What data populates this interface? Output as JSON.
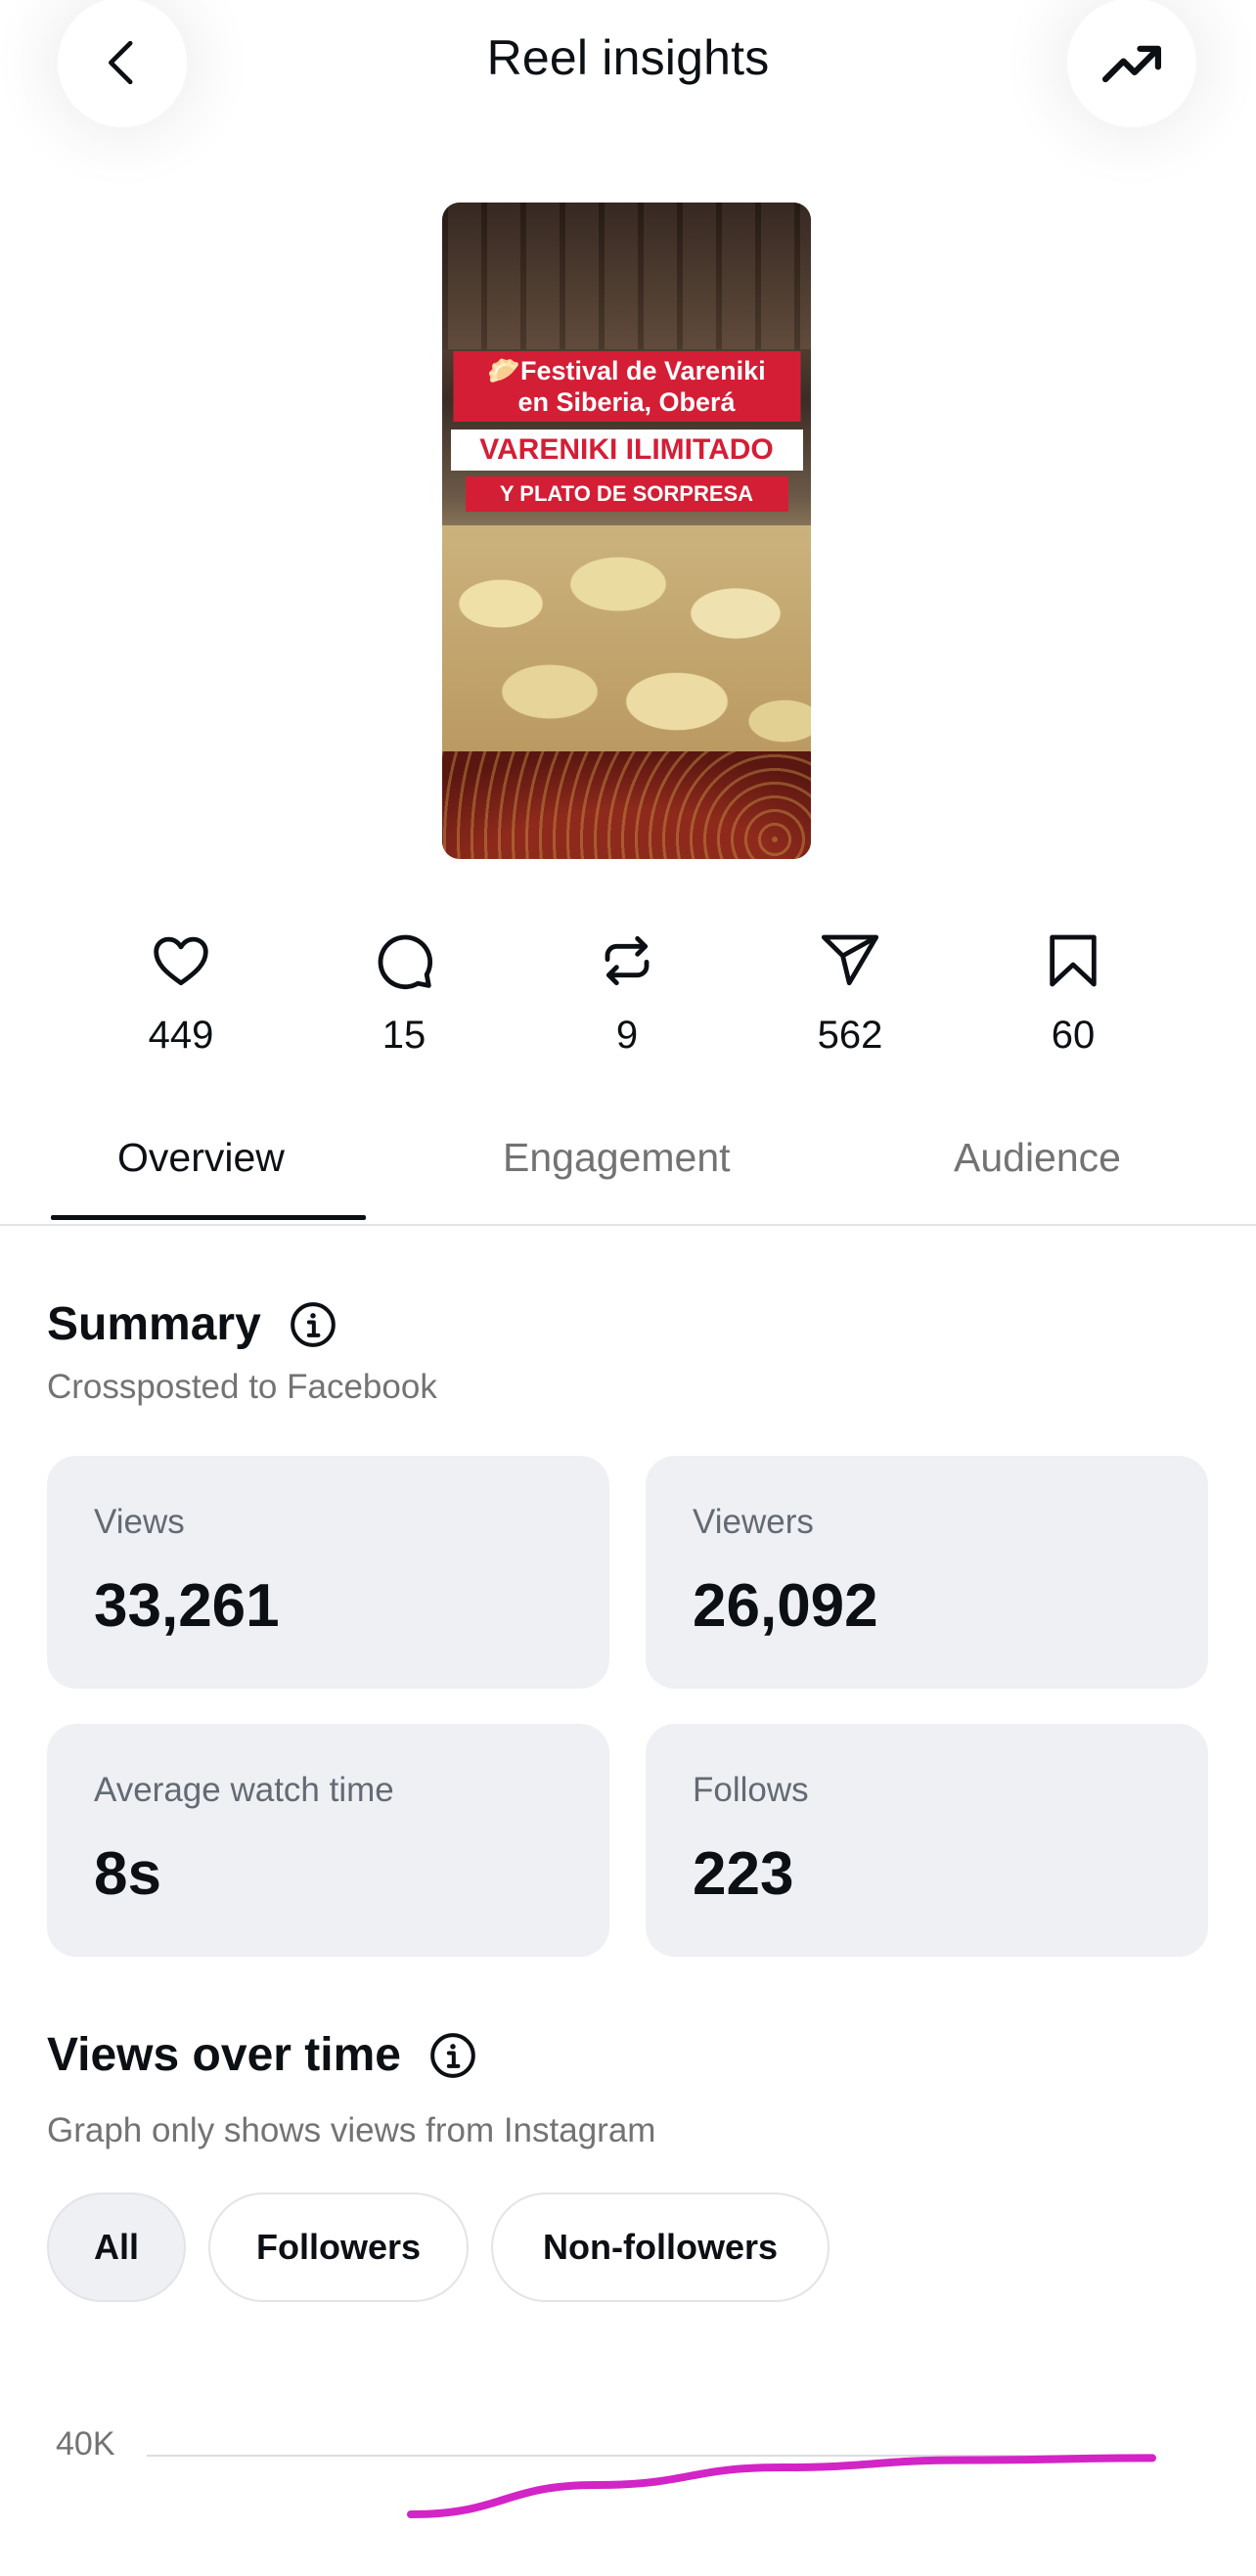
{
  "header": {
    "title": "Reel insights",
    "back_icon": "chevron-left-icon",
    "trend_icon": "trending-up-icon"
  },
  "thumbnail": {
    "caption_line1": "🥟Festival de Vareniki",
    "caption_line2": "en Siberia, Oberá",
    "caption_highlight": "VARENIKI ILIMITADO",
    "caption_sub": "Y PLATO DE SORPRESA"
  },
  "stats": {
    "likes": "449",
    "comments": "15",
    "reposts": "9",
    "shares": "562",
    "saves": "60"
  },
  "tabs": [
    "Overview",
    "Engagement",
    "Audience"
  ],
  "active_tab": "Overview",
  "summary": {
    "title": "Summary",
    "subtitle": "Crossposted to Facebook",
    "cards": [
      {
        "label": "Views",
        "value": "33,261"
      },
      {
        "label": "Viewers",
        "value": "26,092"
      },
      {
        "label": "Average watch time",
        "value": "8s"
      },
      {
        "label": "Follows",
        "value": "223"
      }
    ]
  },
  "views_over_time": {
    "title": "Views over time",
    "subtitle": "Graph only shows views from Instagram",
    "filters": [
      "All",
      "Followers",
      "Non-followers"
    ],
    "selected_filter": "All"
  },
  "colors": {
    "accent_line": "#d324c6",
    "card_bg": "#eff0f4",
    "text_primary": "#0c1014",
    "text_secondary": "#737373"
  },
  "chart_data": {
    "type": "line",
    "y_tick_labels": [
      "40K"
    ],
    "series": [
      {
        "values": [
          20000,
          30000,
          36000,
          38500,
          39200
        ]
      }
    ],
    "grid": true
  }
}
